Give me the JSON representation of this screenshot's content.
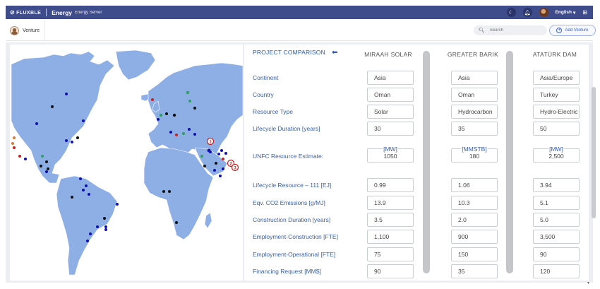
{
  "header": {
    "logo_text": "FLUXBLE",
    "app_name": "Energy",
    "app_sub": "Energy Server",
    "language": "English",
    "icons": [
      "moon-icon",
      "bell-icon",
      "user-avatar",
      "chevron-down-icon",
      "grid-icon"
    ]
  },
  "subheader": {
    "tab_label": "Venture",
    "search_placeholder": "Search",
    "add_button_label": "Add Venture"
  },
  "comparison": {
    "title": "PROJECT COMPARISON",
    "projects": [
      "MIRAAH SOLAR",
      "GREATER BARIK",
      "ATATÜRK DAM"
    ],
    "rows": [
      {
        "label": "Continent",
        "values": [
          "Asia",
          "Asia",
          "Asia/Europe"
        ]
      },
      {
        "label": "Country",
        "values": [
          "Oman",
          "Oman",
          "Turkey"
        ]
      },
      {
        "label": "Resource Type",
        "values": [
          "Solar",
          "Hydrocarbon",
          "Hydro-Electric"
        ]
      },
      {
        "label": "Lifecycle Duration [years]",
        "values": [
          "30",
          "35",
          "50"
        ]
      },
      {
        "label": "UNFC Resource Estimate:",
        "units": [
          "[MW]",
          "[MMSTB]",
          "[MW]"
        ],
        "values": [
          "1050",
          "180",
          "2,500"
        ]
      },
      {
        "label": "Lifecycle Resource – 111 [EJ]",
        "values": [
          "0.99",
          "1.06",
          "3.94"
        ]
      },
      {
        "label": "Eqv. CO2 Emissions [g/MJ]",
        "values": [
          "13.9",
          "10.3",
          "5.1"
        ]
      },
      {
        "label": "Construction Duration [years]",
        "values": [
          "3.5",
          "2.0",
          "5.0"
        ]
      },
      {
        "label": "Employment-Construction [FTE]",
        "values": [
          "1,100",
          "900",
          "3,500"
        ]
      },
      {
        "label": "Employment-Operational [FTE]",
        "values": [
          "75",
          "150",
          "90"
        ]
      },
      {
        "label": "Financing Request [MM$]",
        "values": [
          "90",
          "35",
          "120"
        ]
      }
    ]
  },
  "map": {
    "land_color": "#8eaee6",
    "water_color": "#ffffff",
    "marker_colors": {
      "blue": "#1010b0",
      "black": "#111111",
      "green": "#2ea060",
      "red": "#d02020",
      "orange": "#e07838"
    },
    "highlight_badges": [
      "1",
      "2",
      "3"
    ]
  },
  "colors": {
    "topbar": "#3f4c8c",
    "accent": "#2d59b3"
  }
}
